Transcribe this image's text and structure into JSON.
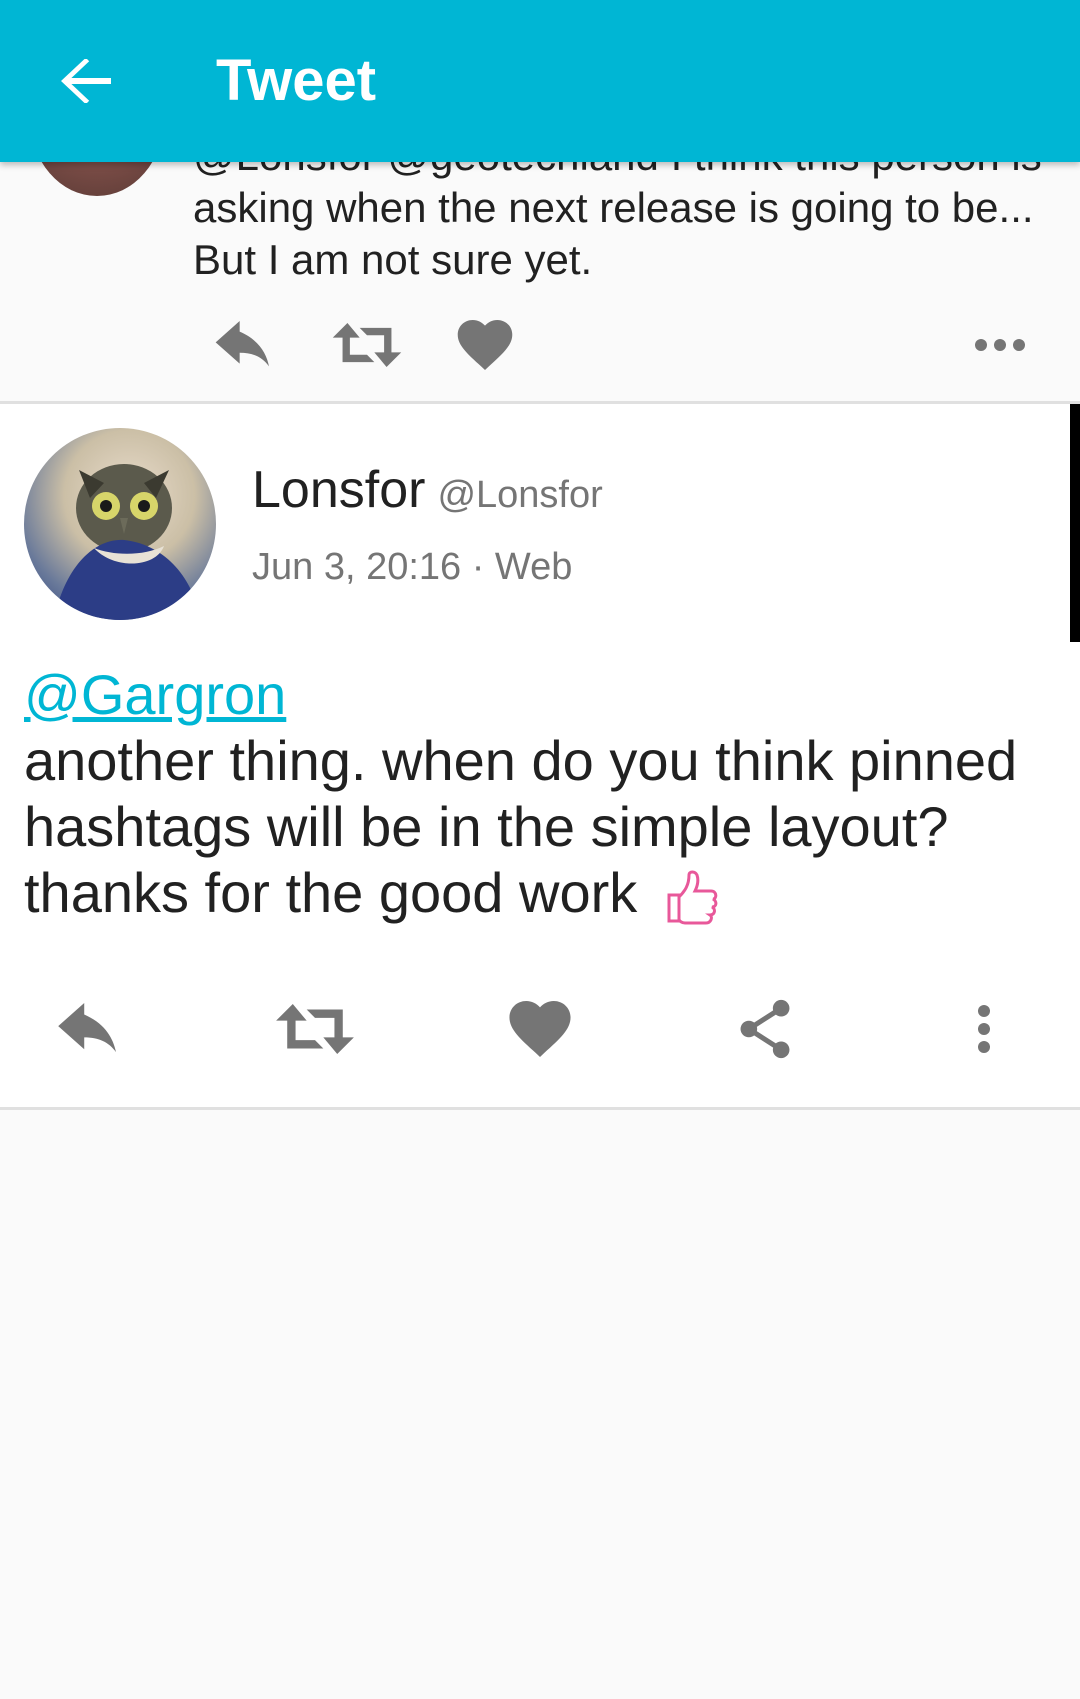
{
  "appbar": {
    "title": "Tweet",
    "background": "#00b6d4",
    "back_icon": "arrow-back-icon"
  },
  "previous_status": {
    "text": "@Lonsfor @geotechland I think this person is asking when the next release is going to be... But I am not sure yet.",
    "actions": [
      "reply-icon",
      "boost-icon",
      "favourite-icon",
      "more-horizontal-icon"
    ]
  },
  "status": {
    "display_name": "Lonsfor",
    "handle": "@Lonsfor",
    "meta": "Jun 3, 20:16 · Web",
    "mention": "@Gargron",
    "body": "another thing. when do you think pinned hashtags will be in the simple layout? thanks for the good work",
    "emoji": "thumbs-up-icon",
    "actions": [
      "reply-icon",
      "boost-icon",
      "favourite-icon",
      "share-icon",
      "more-vertical-icon"
    ]
  },
  "colors": {
    "accent": "#00b6d4",
    "icon": "#757575",
    "text": "#212121",
    "secondary_text": "#757575"
  }
}
